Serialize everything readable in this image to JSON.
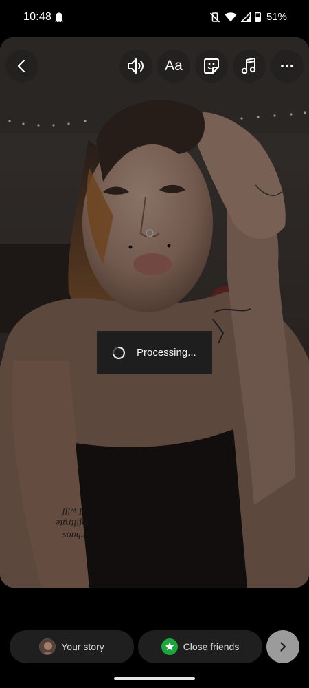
{
  "status_bar": {
    "time": "10:48",
    "battery": "51%"
  },
  "toolbar": {
    "text_tool_label": "Aa"
  },
  "overlay": {
    "processing_text": "Processing..."
  },
  "photo": {
    "tattoo_text": [
      "I will",
      "infiltrate",
      "chaos"
    ]
  },
  "share_bar": {
    "your_story_label": "Your story",
    "close_friends_label": "Close friends"
  },
  "colors": {
    "close_friends_green": "#1fa540",
    "next_button": "#9b9b9b",
    "pill_bg": "#1f1f1f"
  }
}
